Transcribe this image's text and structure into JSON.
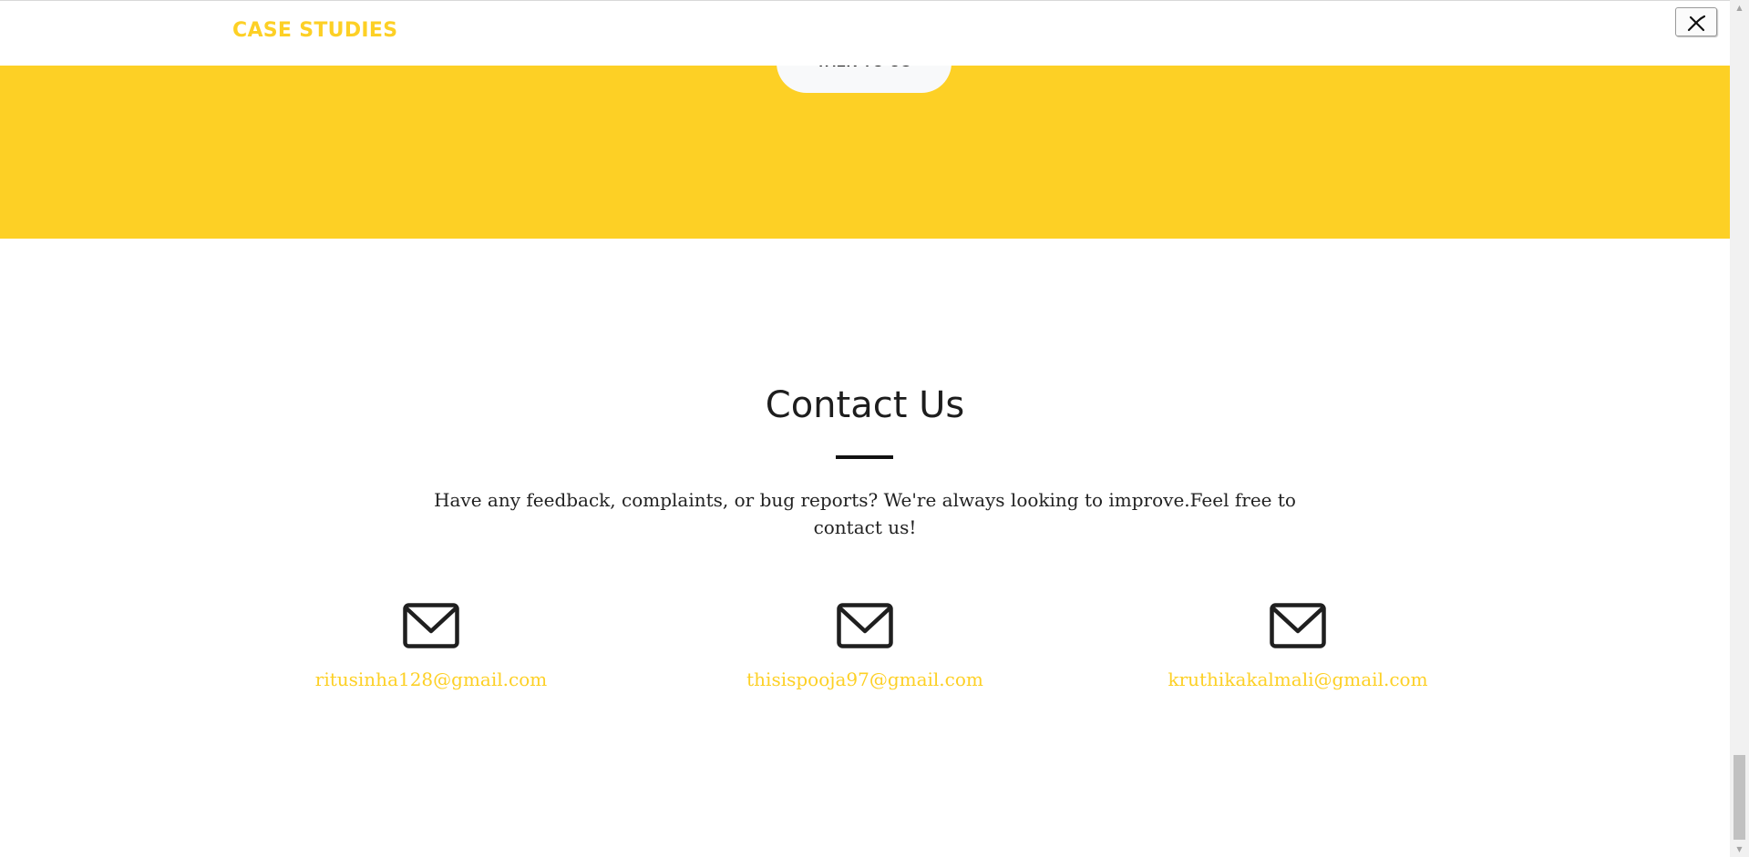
{
  "navbar": {
    "link_label": "CASE STUDIES"
  },
  "hero": {
    "cta_label": "TALK TO US"
  },
  "contact": {
    "title": "Contact Us",
    "description": "Have any feedback, complaints, or bug reports? We're always looking to improve.Feel free to contact us!",
    "cards": [
      {
        "icon": "envelope-icon",
        "email": "ritusinha128@gmail.com"
      },
      {
        "icon": "envelope-icon",
        "email": "thisispooja97@gmail.com"
      },
      {
        "icon": "envelope-icon",
        "email": "kruthikakalmali@gmail.com"
      }
    ]
  },
  "colors": {
    "accent": "#fdd025",
    "text": "#1d1d1d"
  }
}
